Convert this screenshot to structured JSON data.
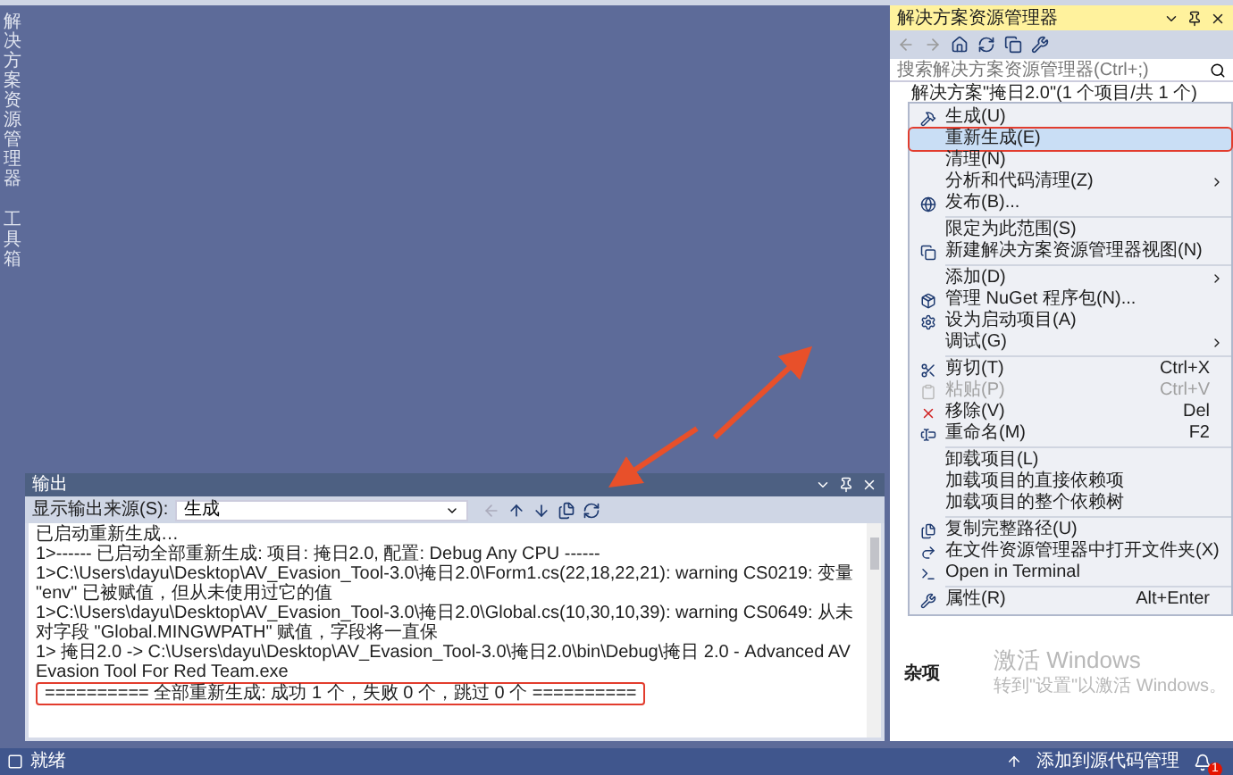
{
  "side_tabs": [
    {
      "label": "解决方案资源管理器"
    },
    {
      "label": "工具箱"
    }
  ],
  "output": {
    "title": "输出",
    "source_label": "显示输出来源(S):",
    "source_value": "生成",
    "lines": [
      {
        "text": "已启动重新生成…",
        "annotated": false
      },
      {
        "text": "1>------ 已启动全部重新生成: 项目: 掩日2.0, 配置: Debug Any CPU ------",
        "annotated": false
      },
      {
        "text": "1>C:\\Users\\dayu\\Desktop\\AV_Evasion_Tool-3.0\\掩日2.0\\Form1.cs(22,18,22,21): warning CS0219: 变量 \"env\" 已被赋值，但从未使用过它的值",
        "annotated": false
      },
      {
        "text": "1>C:\\Users\\dayu\\Desktop\\AV_Evasion_Tool-3.0\\掩日2.0\\Global.cs(10,30,10,39): warning CS0649: 从未对字段 \"Global.MINGWPATH\" 赋值，字段将一直保",
        "annotated": false
      },
      {
        "text": "1>  掩日2.0 -> C:\\Users\\dayu\\Desktop\\AV_Evasion_Tool-3.0\\掩日2.0\\bin\\Debug\\掩日 2.0 - Advanced AV Evasion Tool For Red Team.exe",
        "annotated": false
      },
      {
        "text": "========== 全部重新生成: 成功 1 个，失败 0 个，跳过 0 个 ==========",
        "annotated": true
      }
    ]
  },
  "solution_explorer": {
    "title": "解决方案资源管理器",
    "search_placeholder": "搜索解决方案资源管理器(Ctrl+;)",
    "tree": [
      {
        "label": "解决方案\"掩日2.0\"(1 个项目/共 1 个)"
      }
    ]
  },
  "context_menu": [
    {
      "kind": "item",
      "label": "生成(U)",
      "selected": false,
      "annotated": false,
      "disabled": false,
      "submenu": false
    },
    {
      "kind": "item",
      "label": "重新生成(E)",
      "selected": true,
      "annotated": true,
      "disabled": false,
      "submenu": false
    },
    {
      "kind": "item",
      "label": "清理(N)",
      "selected": false,
      "annotated": false,
      "disabled": false,
      "submenu": false
    },
    {
      "kind": "item",
      "label": "分析和代码清理(Z)",
      "selected": false,
      "annotated": false,
      "disabled": false,
      "submenu": true
    },
    {
      "kind": "item",
      "label": "发布(B)...",
      "selected": false,
      "annotated": false,
      "disabled": false,
      "submenu": false
    },
    {
      "kind": "separator"
    },
    {
      "kind": "item",
      "label": "限定为此范围(S)",
      "selected": false,
      "annotated": false,
      "disabled": false,
      "submenu": false
    },
    {
      "kind": "item",
      "label": "新建解决方案资源管理器视图(N)",
      "selected": false,
      "annotated": false,
      "disabled": false,
      "submenu": false
    },
    {
      "kind": "separator"
    },
    {
      "kind": "item",
      "label": "添加(D)",
      "selected": false,
      "annotated": false,
      "disabled": false,
      "submenu": true
    },
    {
      "kind": "item",
      "label": "管理 NuGet 程序包(N)...",
      "selected": false,
      "annotated": false,
      "disabled": false,
      "submenu": false
    },
    {
      "kind": "item",
      "label": "设为启动项目(A)",
      "selected": false,
      "annotated": false,
      "disabled": false,
      "submenu": false
    },
    {
      "kind": "item",
      "label": "调试(G)",
      "selected": false,
      "annotated": false,
      "disabled": false,
      "submenu": true
    },
    {
      "kind": "separator"
    },
    {
      "kind": "item",
      "label": "剪切(T)",
      "shortcut": "Ctrl+X",
      "selected": false,
      "annotated": false,
      "disabled": false,
      "submenu": false
    },
    {
      "kind": "item",
      "label": "粘贴(P)",
      "shortcut": "Ctrl+V",
      "selected": false,
      "annotated": false,
      "disabled": true,
      "submenu": false
    },
    {
      "kind": "item",
      "label": "移除(V)",
      "shortcut": "Del",
      "selected": false,
      "annotated": false,
      "disabled": false,
      "submenu": false
    },
    {
      "kind": "item",
      "label": "重命名(M)",
      "shortcut": "F2",
      "selected": false,
      "annotated": false,
      "disabled": false,
      "submenu": false
    },
    {
      "kind": "separator"
    },
    {
      "kind": "item",
      "label": "卸载项目(L)",
      "selected": false,
      "annotated": false,
      "disabled": false,
      "submenu": false
    },
    {
      "kind": "item",
      "label": "加载项目的直接依赖项",
      "selected": false,
      "annotated": false,
      "disabled": false,
      "submenu": false
    },
    {
      "kind": "item",
      "label": "加载项目的整个依赖树",
      "selected": false,
      "annotated": false,
      "disabled": false,
      "submenu": false
    },
    {
      "kind": "separator"
    },
    {
      "kind": "item",
      "label": "复制完整路径(U)",
      "selected": false,
      "annotated": false,
      "disabled": false,
      "submenu": false
    },
    {
      "kind": "item",
      "label": "在文件资源管理器中打开文件夹(X)",
      "selected": false,
      "annotated": false,
      "disabled": false,
      "submenu": false
    },
    {
      "kind": "item",
      "label": "Open in Terminal",
      "selected": false,
      "annotated": false,
      "disabled": false,
      "submenu": false
    },
    {
      "kind": "separator"
    },
    {
      "kind": "item",
      "label": "属性(R)",
      "shortcut": "Alt+Enter",
      "selected": false,
      "annotated": false,
      "disabled": false,
      "submenu": false
    }
  ],
  "properties": {
    "section": "杂项"
  },
  "activation_notice": {
    "title": "激活 Windows",
    "subtitle": "转到\"设置\"以激活 Windows。"
  },
  "status_bar": {
    "left": "就绪",
    "source_control": "添加到源代码管理",
    "notification_count": "1"
  }
}
